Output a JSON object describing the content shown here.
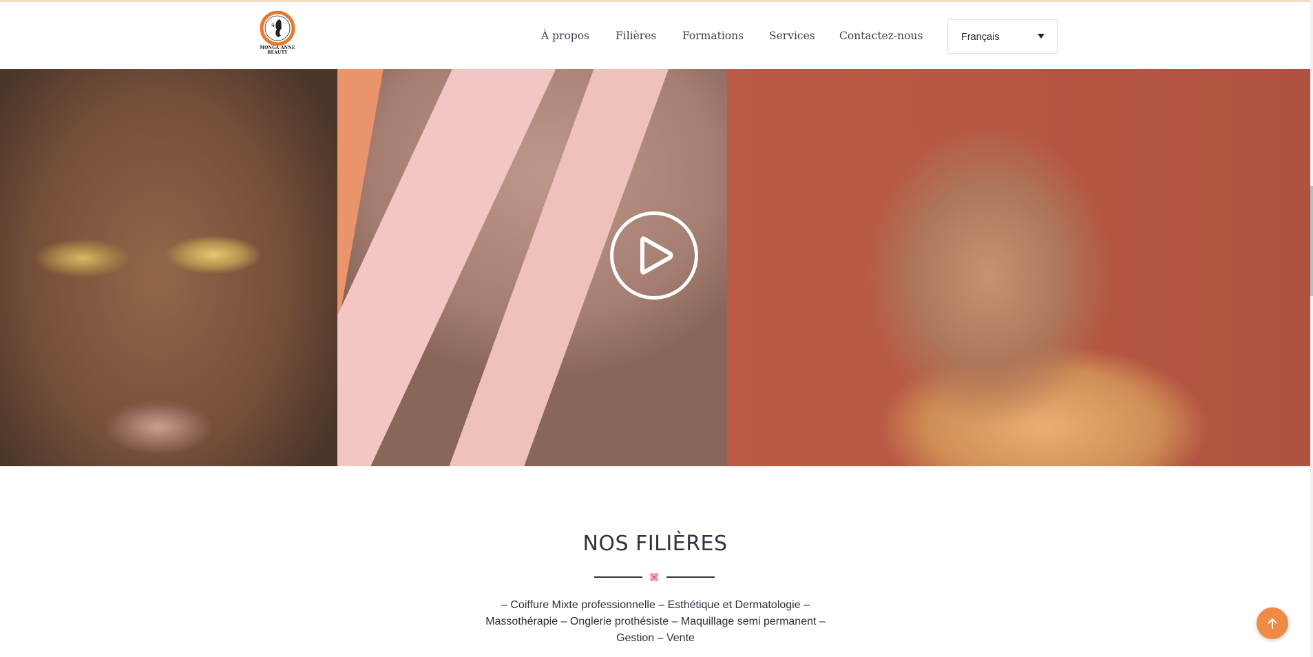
{
  "brand": {
    "logo_text": "MONGA ANNE BEAUTY"
  },
  "nav": {
    "items": [
      {
        "label": "À propos"
      },
      {
        "label": "Filières"
      },
      {
        "label": "Formations"
      },
      {
        "label": "Services"
      },
      {
        "label": "Contactez-nous"
      }
    ]
  },
  "language_select": {
    "selected": "Français"
  },
  "section": {
    "title": "NOS FILIÈRES",
    "description": "– Coiffure Mixte professionnelle – Esthétique et Dermatologie – Massothérapie – Onglerie prothésiste – Maquillage semi permanent – Gestion – Vente"
  },
  "colors": {
    "accent": "#f08a45",
    "text_dark": "#2f3440",
    "flower": "#f19bb2"
  },
  "icons": {
    "play": "play-icon",
    "scroll_top": "arrow-up-icon",
    "flower": "flower-icon"
  }
}
